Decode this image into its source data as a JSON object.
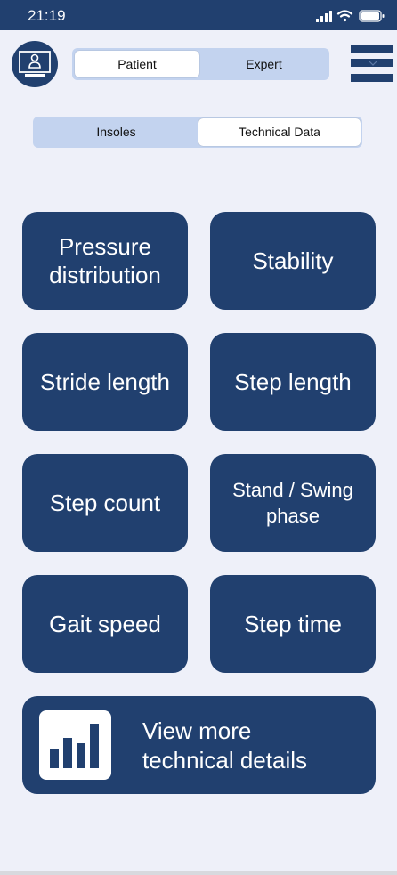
{
  "status_bar": {
    "time": "21:19"
  },
  "header": {
    "avatar_icon": "user-at-computer-icon",
    "mode_toggle": {
      "options": [
        "Patient",
        "Expert"
      ],
      "selected": "Patient"
    },
    "menu_icon": "hamburger-menu-icon"
  },
  "data_toggle": {
    "options": [
      "Insoles",
      "Technical Data"
    ],
    "selected": "Technical Data"
  },
  "metrics": [
    "Pressure distribution",
    "Stability",
    "Stride length",
    "Step length",
    "Step count",
    "Stand / Swing phase",
    "Gait speed",
    "Step time"
  ],
  "details_button": {
    "icon": "bar-chart-icon",
    "line1": "View more",
    "line2": "technical details"
  },
  "colors": {
    "primary": "#21406f",
    "toggle_bg": "#c3d3ef",
    "page_bg": "#eef0f9"
  }
}
